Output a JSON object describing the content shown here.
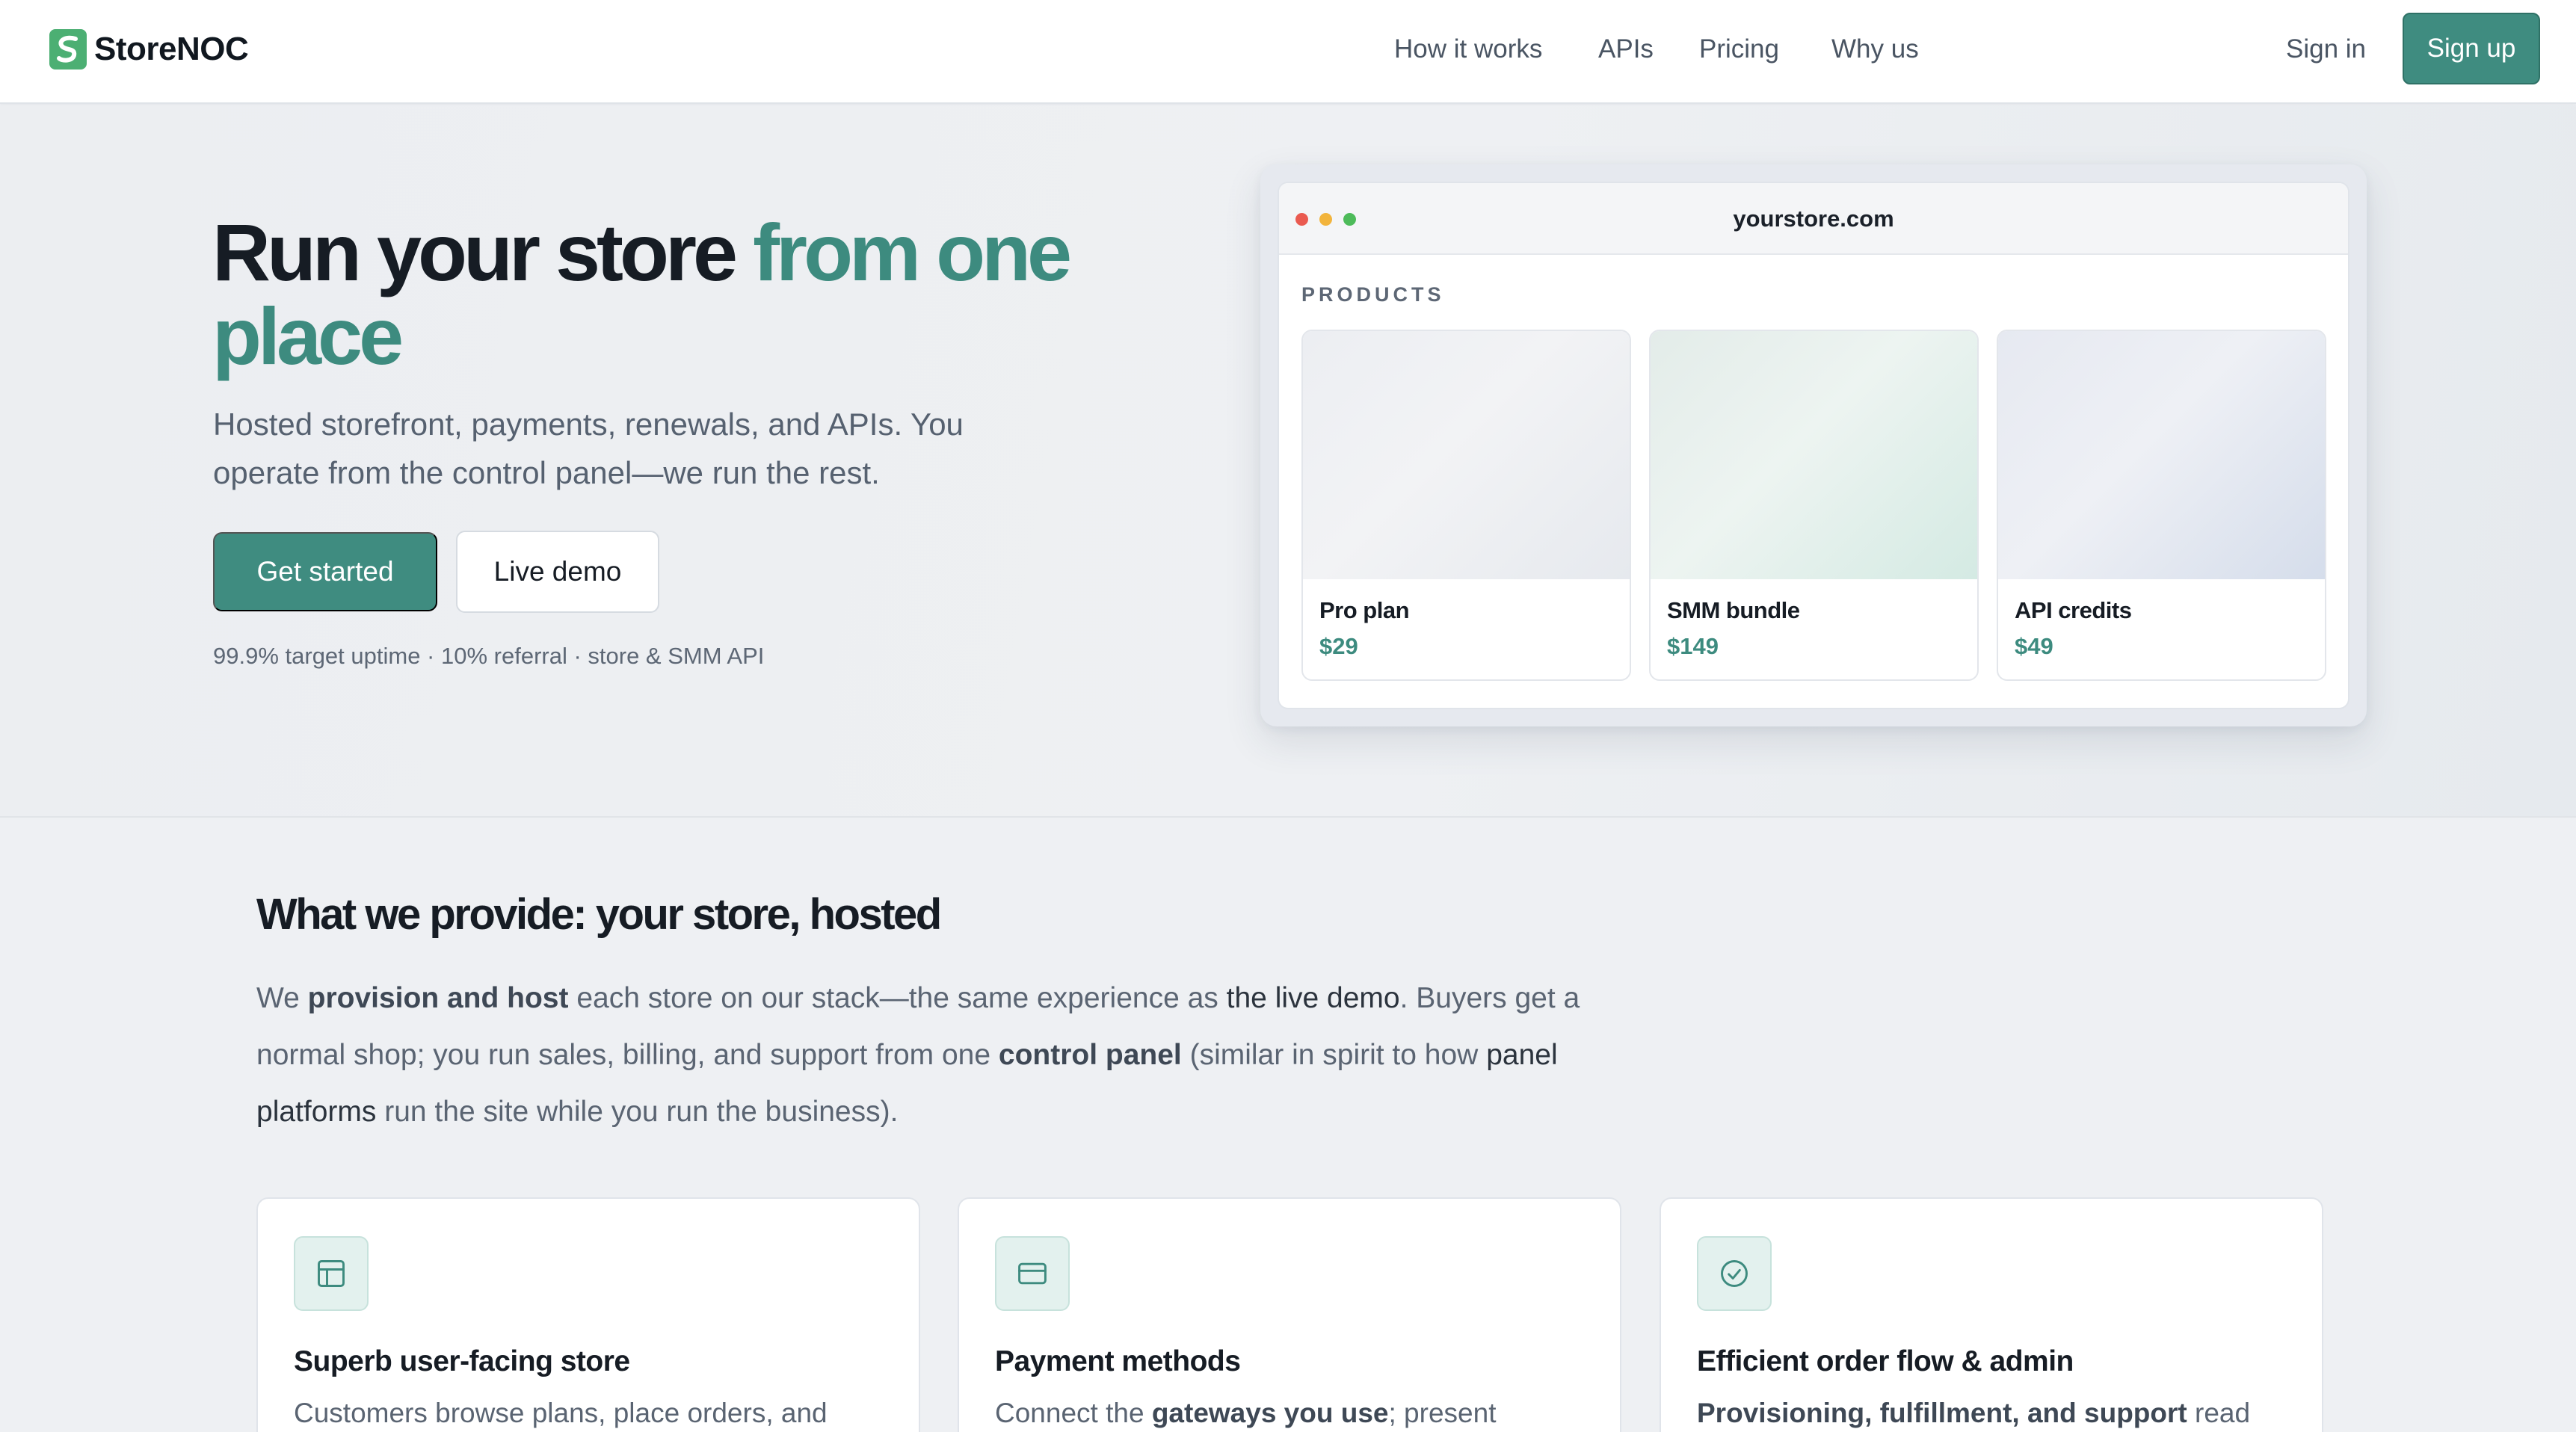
{
  "brand": {
    "name": "StoreNOC"
  },
  "nav": {
    "links": [
      "How it works",
      "APIs",
      "Pricing",
      "Why us"
    ],
    "sign_in": "Sign in",
    "sign_up": "Sign up"
  },
  "hero": {
    "title_main": "Run your store ",
    "title_accent": "from one place",
    "subtitle": "Hosted storefront, payments, renewals, and APIs. You operate from the control panel—we run the rest.",
    "cta_primary": "Get started",
    "cta_secondary": "Live demo",
    "note": "99.9% target uptime · 10% referral · store & SMM API"
  },
  "mockup": {
    "url": "yourstore.com",
    "section_label": "PRODUCTS",
    "products": [
      {
        "name": "Pro plan",
        "price": "$29"
      },
      {
        "name": "SMM bundle",
        "price": "$149"
      },
      {
        "name": "API credits",
        "price": "$49"
      }
    ]
  },
  "provide": {
    "title": "What we provide: your store, hosted",
    "body": {
      "p1": "We ",
      "b1": "provision and host",
      "p2": " each store on our stack—the same experience as ",
      "h1": "the live demo",
      "p3": ". Buyers get a normal shop; you run sales, billing, and support from one ",
      "b2": "control panel",
      "p4": " (similar in spirit to how ",
      "h2": "panel platforms",
      "p5": " run the site while you run the business)."
    },
    "features": [
      {
        "title": "Superb user-facing store",
        "desc_plain": "Customers browse plans, place orders, and"
      },
      {
        "title": "Payment methods",
        "desc_pre": "Connect the ",
        "desc_bold": "gateways you use",
        "desc_post": "; present"
      },
      {
        "title": "Efficient order flow & admin",
        "desc_bold": "Provisioning, fulfillment, and support",
        "desc_post": " read"
      }
    ]
  },
  "colors": {
    "accent": "#3f8c80",
    "brand_logo": "#4caf73"
  },
  "icons": [
    "storenoc-logo-icon",
    "layout-icon",
    "credit-card-icon",
    "check-circle-icon"
  ]
}
